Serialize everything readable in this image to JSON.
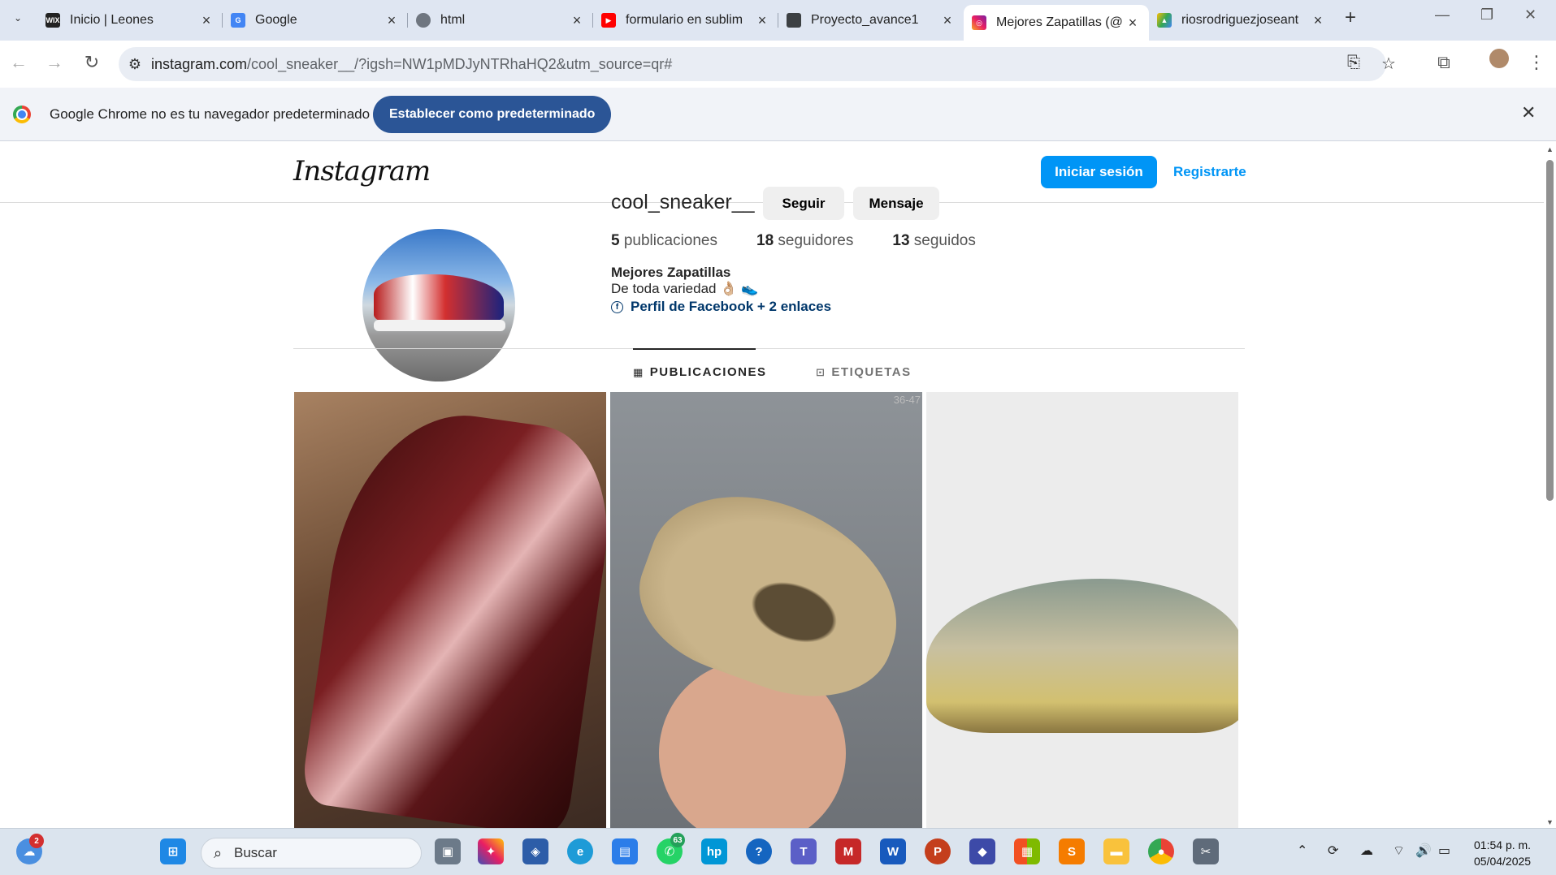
{
  "browser": {
    "tabs": [
      {
        "title": "Inicio | Leones",
        "favicon": "wix-icon",
        "fav_text": "WIX"
      },
      {
        "title": "Google",
        "favicon": "google-icon",
        "fav_text": "G"
      },
      {
        "title": "html",
        "favicon": "globe-icon",
        "fav_text": ""
      },
      {
        "title": "formulario en sublim",
        "favicon": "youtube-icon",
        "fav_text": "▶"
      },
      {
        "title": "Proyecto_avance1",
        "favicon": "classroom-icon",
        "fav_text": ""
      },
      {
        "title": "Mejores Zapatillas (@",
        "favicon": "instagram-icon",
        "fav_text": "◎"
      },
      {
        "title": "riosrodriguezjoseant",
        "favicon": "drive-icon",
        "fav_text": "▲"
      }
    ],
    "active_tab": 5,
    "url_domain": "instagram.com",
    "url_path": "/cool_sneaker__/?igsh=NW1pMDJyNTRhaHQ2&utm_source=qr#",
    "infobar_text": "Google Chrome no es tu navegador predeterminado",
    "infobar_button": "Establecer como predeterminado"
  },
  "instagram": {
    "logo": "Instagram",
    "login": "Iniciar sesión",
    "register": "Registrarte",
    "profile": {
      "username": "cool_sneaker__",
      "follow": "Seguir",
      "message": "Mensaje",
      "posts_count": "5",
      "posts_label": "publicaciones",
      "followers_count": "18",
      "followers_label": "seguidores",
      "following_count": "13",
      "following_label": "seguidos",
      "bio_name": "Mejores Zapatillas",
      "bio_text": "De toda variedad 👌🏼 👟",
      "bio_link": "Perfil de Facebook + 2 enlaces"
    },
    "tabs": {
      "posts": "PUBLICACIONES",
      "tagged": "ETIQUETAS"
    },
    "posts": [
      {
        "alt": "brown leather loafer"
      },
      {
        "alt": "foam runner sneaker",
        "overlay": "36-47"
      },
      {
        "alt": "sneaker on grey background"
      }
    ]
  },
  "taskbar": {
    "search_placeholder": "Buscar",
    "weather_badge": "2",
    "whatsapp_badge": "63",
    "time": "01:54 p. m.",
    "date": "05/04/2025"
  },
  "colors": {
    "ig_blue": "#0095f6",
    "infobar_button": "#2b5596",
    "tab_strip": "#dfe6f2"
  }
}
